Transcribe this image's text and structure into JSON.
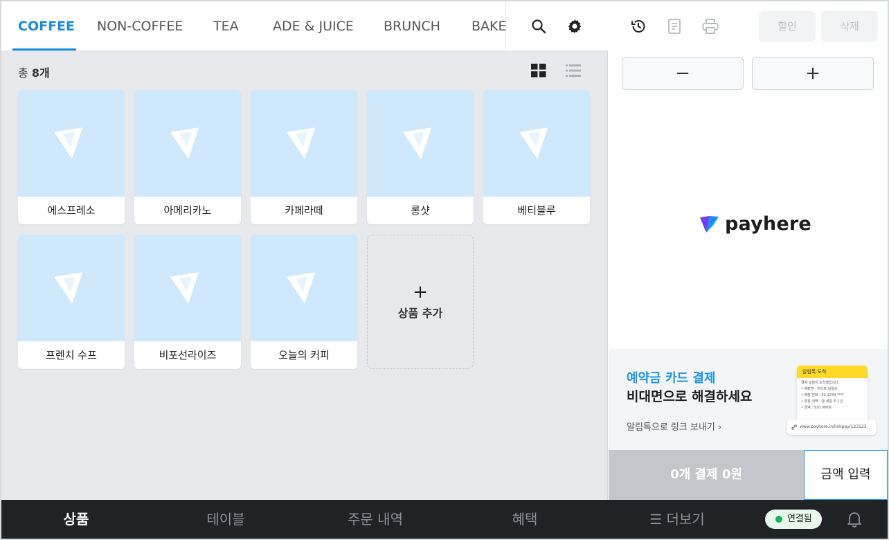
{
  "categories": [
    "COFFEE",
    "NON-COFFEE",
    "TEA",
    "ADE & JUICE",
    "BRUNCH",
    "BAKE"
  ],
  "active_category": "COFFEE",
  "count": {
    "prefix": "총",
    "value": "8개"
  },
  "products": [
    "에스프레소",
    "아메리카노",
    "카페라떼",
    "롱샷",
    "베티블루",
    "프렌치 수프",
    "비포선라이즈",
    "오늘의 커피"
  ],
  "add_product": {
    "plus": "+",
    "label": "상품 추가"
  },
  "order_panel": {
    "discount_label": "할인",
    "delete_label": "삭제",
    "minus_label": "−",
    "plus_label": "+",
    "logo_text": "payhere",
    "promo": {
      "title": "예약금 카드 결제",
      "subtitle": "비대면으로 해결하세요",
      "link": "알림톡으로 링크 보내기 ›",
      "phone_header": "알림톡 도착",
      "phone_lines": [
        "결제 요청이 도착했습니다.",
        "• 매장명 : 허이프 내일상",
        "• 매장 전화 : 02-1234-****",
        "• 주문 내역 : 웰 세일 외 1건",
        "• 금액 : 520,000원"
      ],
      "url": "www.payhere.in/linkpay/123123"
    },
    "pay_label": "0개 결제  0원",
    "amount_input_label": "금액 입력"
  },
  "bottom_nav": {
    "items": [
      "상품",
      "테이블",
      "주문 내역",
      "혜택",
      "☰ 더보기"
    ],
    "active": "상품",
    "connection_status": "연결됨"
  },
  "colors": {
    "accent": "#1a8cdc",
    "nav_bg": "#1f2326",
    "product_bg": "#cfe8fc",
    "connected": "#19b35a"
  }
}
